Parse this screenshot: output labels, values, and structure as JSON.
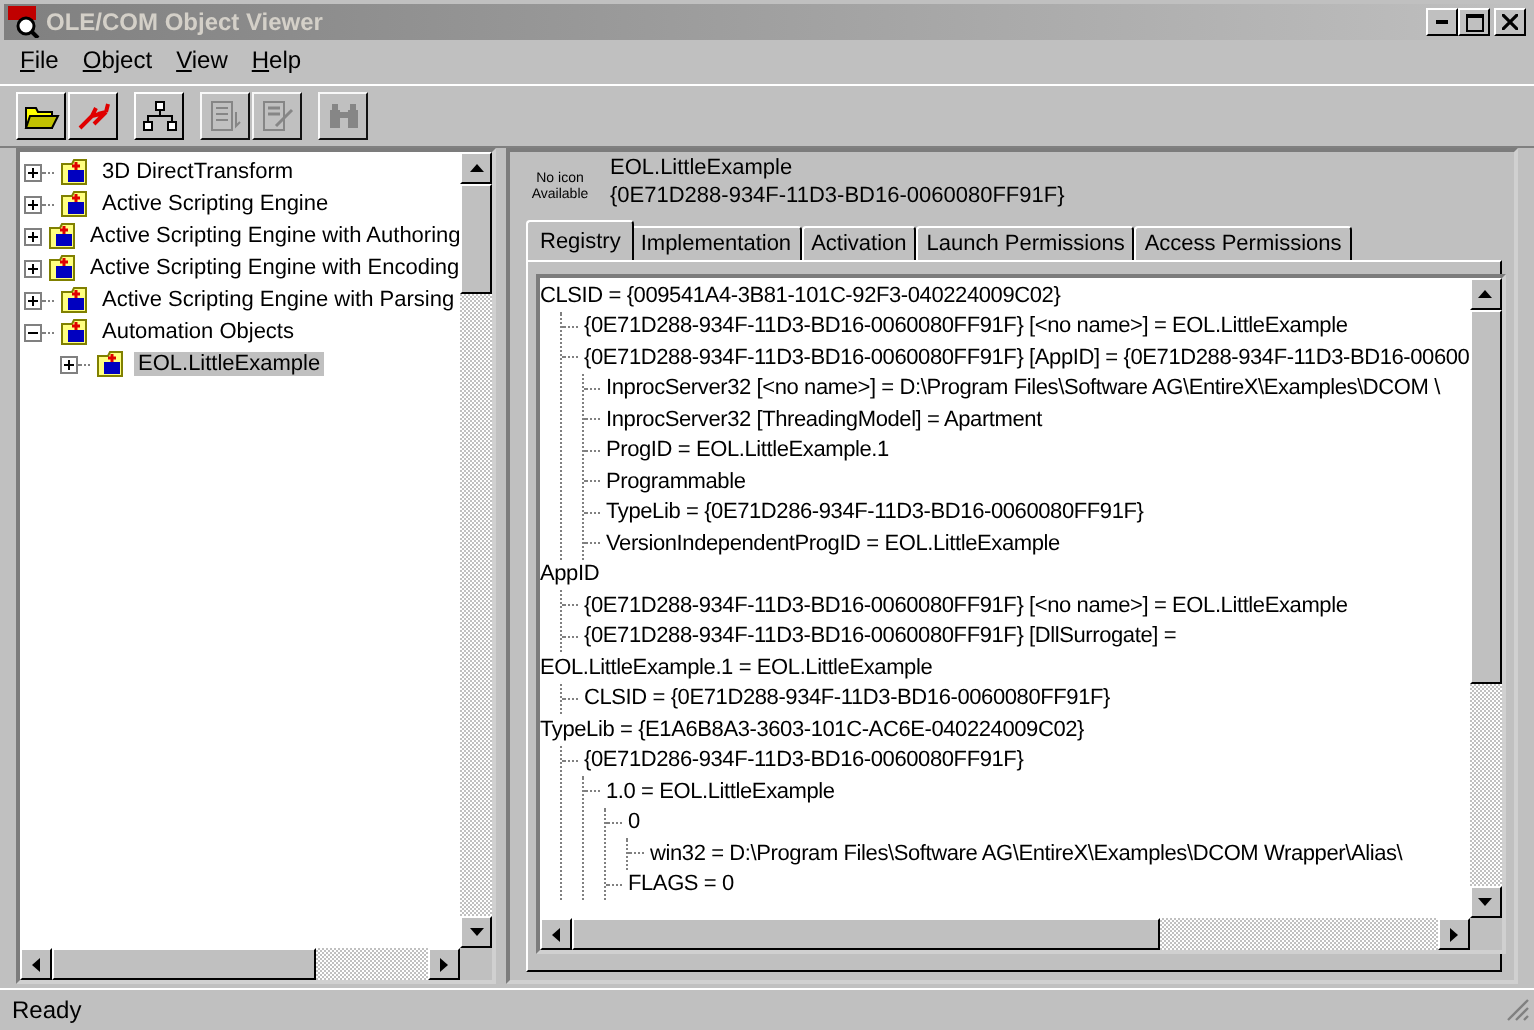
{
  "window": {
    "title": "OLE/COM Object Viewer"
  },
  "menu": [
    {
      "label": "File"
    },
    {
      "label": "Object"
    },
    {
      "label": "View"
    },
    {
      "label": "Help"
    }
  ],
  "toolbar": [
    {
      "kind": "open",
      "disabled": false
    },
    {
      "kind": "connect",
      "disabled": false
    },
    {
      "kind": "hierarchy",
      "disabled": false
    },
    {
      "kind": "list",
      "disabled": true
    },
    {
      "kind": "edit",
      "disabled": true
    },
    {
      "kind": "find",
      "disabled": true
    }
  ],
  "object_tree": [
    {
      "label": "3D DirectTransform",
      "expanded": false,
      "selected": false
    },
    {
      "label": "Active Scripting Engine",
      "expanded": false,
      "selected": false
    },
    {
      "label": "Active Scripting Engine with Authoring",
      "expanded": false,
      "selected": false
    },
    {
      "label": "Active Scripting Engine with Encoding",
      "expanded": false,
      "selected": false
    },
    {
      "label": "Active Scripting Engine with Parsing",
      "expanded": false,
      "selected": false
    },
    {
      "label": "Automation Objects",
      "expanded": true,
      "selected": false,
      "children": [
        {
          "label": "EOL.LittleExample",
          "expanded": false,
          "selected": true
        }
      ]
    }
  ],
  "details": {
    "icon_text": "No icon Available",
    "name": "EOL.LittleExample",
    "guid": "{0E71D288-934F-11D3-BD16-0060080FF91F}"
  },
  "tabs": [
    {
      "label": "Registry",
      "selected": true
    },
    {
      "label": "Implementation",
      "selected": false
    },
    {
      "label": "Activation",
      "selected": false
    },
    {
      "label": "Launch Permissions",
      "selected": false
    },
    {
      "label": "Access Permissions",
      "selected": false
    }
  ],
  "registry_tree": [
    {
      "text": "CLSID = {009541A4-3B81-101C-92F3-040224009C02}",
      "children": [
        {
          "text": "{0E71D288-934F-11D3-BD16-0060080FF91F} [<no name>] = EOL.LittleExample"
        },
        {
          "text": "{0E71D288-934F-11D3-BD16-0060080FF91F} [AppID] = {0E71D288-934F-11D3-BD16-00600",
          "children": [
            {
              "text": "InprocServer32 [<no name>] = D:\\Program Files\\Software AG\\EntireX\\Examples\\DCOM \\"
            },
            {
              "text": "InprocServer32 [ThreadingModel] = Apartment"
            },
            {
              "text": "ProgID = EOL.LittleExample.1"
            },
            {
              "text": "Programmable"
            },
            {
              "text": "TypeLib = {0E71D286-934F-11D3-BD16-0060080FF91F}"
            },
            {
              "text": "VersionIndependentProgID = EOL.LittleExample"
            }
          ]
        }
      ]
    },
    {
      "text": "AppID",
      "children": [
        {
          "text": "{0E71D288-934F-11D3-BD16-0060080FF91F} [<no name>] = EOL.LittleExample"
        },
        {
          "text": "{0E71D288-934F-11D3-BD16-0060080FF91F} [DllSurrogate] ="
        }
      ]
    },
    {
      "text": "EOL.LittleExample.1 = EOL.LittleExample",
      "children": [
        {
          "text": "CLSID = {0E71D288-934F-11D3-BD16-0060080FF91F}"
        }
      ]
    },
    {
      "text": "TypeLib = {E1A6B8A3-3603-101C-AC6E-040224009C02}",
      "children": [
        {
          "text": "{0E71D286-934F-11D3-BD16-0060080FF91F}",
          "children": [
            {
              "text": "1.0 = EOL.LittleExample",
              "children": [
                {
                  "text": "0",
                  "children": [
                    {
                      "text": "win32 = D:\\Program Files\\Software AG\\EntireX\\Examples\\DCOM Wrapper\\Alias\\"
                    }
                  ]
                },
                {
                  "text": "FLAGS = 0"
                }
              ]
            }
          ]
        }
      ]
    }
  ],
  "status_bar": {
    "text": "Ready"
  }
}
